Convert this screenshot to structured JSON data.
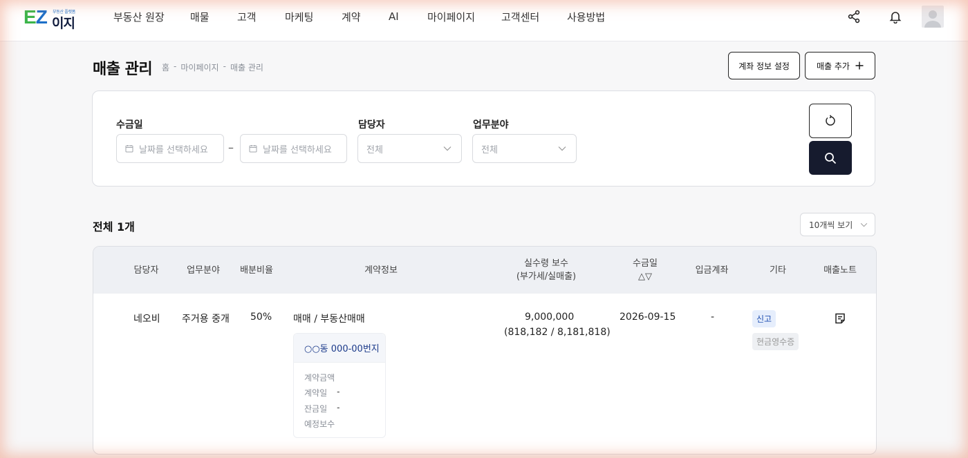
{
  "logo": {
    "ez_e": "E",
    "ez_z": "Z",
    "tagline": "부동산 플랫폼",
    "ij": "이지"
  },
  "nav": [
    "부동산 원장",
    "매물",
    "고객",
    "마케팅",
    "계약",
    "AI",
    "마이페이지",
    "고객센터",
    "사용방법"
  ],
  "header_icons": [
    "share-icon",
    "bell-icon",
    "user-avatar-icon"
  ],
  "page": {
    "title": "매출 관리",
    "breadcrumb": [
      "홈",
      "-",
      "마이페이지",
      "-",
      "매출 관리"
    ],
    "buttons": {
      "account_settings": "계좌 정보 설정",
      "add_sale": "매출 추가"
    }
  },
  "filters": {
    "date_label": "수금일",
    "date_from_placeholder": "날짜를 선택하세요",
    "date_to_placeholder": "날짜를 선택하세요",
    "date_separator": "–",
    "manager_label": "담당자",
    "manager_value": "전체",
    "field_label": "업무분야",
    "field_value": "전체"
  },
  "results": {
    "total": "전체 1개",
    "page_size": "10개씩 보기"
  },
  "table": {
    "headers": {
      "manager": "담당자",
      "field": "업무분야",
      "ratio": "배분비율",
      "contract": "계약정보",
      "fee_line1": "실수령 보수",
      "fee_line2": "(부가세/실매출)",
      "date_line1": "수금일",
      "date_line2": "△▽",
      "account": "입금계좌",
      "etc": "기타",
      "note": "매출노트"
    },
    "row": {
      "manager": "네오비",
      "field": "주거용 중개",
      "ratio": "50%",
      "contract_type": "매매 / 부동산매매",
      "address": "○○동 000-00번지",
      "contract_amount_label": "계약금액",
      "contract_amount_value": "",
      "contract_date_label": "계약일",
      "contract_date_value": "-",
      "balance_date_label": "잔금일",
      "balance_date_value": "-",
      "expected_fee_label": "예정보수",
      "expected_fee_value": "",
      "fee": "9,000,000",
      "fee_breakdown": "(818,182 / 8,181,818)",
      "date": "2026-09-15",
      "account": "-",
      "badge_report": "신고",
      "badge_receipt": "현금영수증"
    }
  }
}
